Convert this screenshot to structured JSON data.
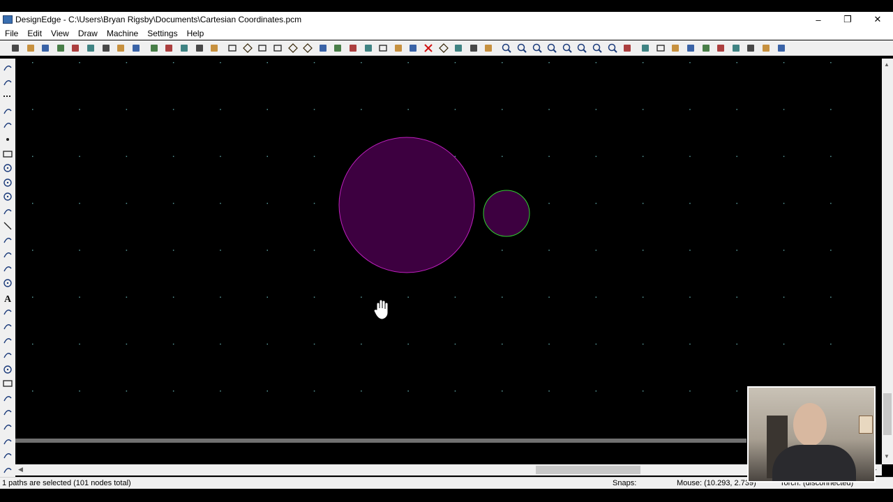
{
  "window": {
    "title": "DesignEdge - C:\\Users\\Bryan Rigsby\\Documents\\Cartesian Coordinates.pcm",
    "minimize_glyph": "–",
    "restore_glyph": "❐",
    "close_glyph": "✕"
  },
  "menu": [
    "File",
    "Edit",
    "View",
    "Draw",
    "Machine",
    "Settings",
    "Help"
  ],
  "toolbar_icons": [
    "new-file",
    "open-folder",
    "save",
    "save-all",
    "import",
    "export",
    "print",
    "print-preview",
    "properties",
    "undo",
    "redo",
    "copy",
    "paste",
    "duplicate",
    "rectangle-select",
    "parallelogram",
    "square-small",
    "rectangle",
    "diamond",
    "parallelogram-2",
    "path-arrow",
    "path-curve",
    "scissors",
    "cut-line",
    "frame",
    "explode",
    "pointer-edit",
    "delete-red",
    "rhombus",
    "loop",
    "hook",
    "cut-pattern",
    "zoom-in",
    "zoom-out",
    "zoom-window",
    "zoom-pan",
    "zoom-extents",
    "zoom-page",
    "zoom-select",
    "zoom-refresh",
    "ruler",
    "arrow-pointer",
    "select-box",
    "select-cross",
    "fill-gray",
    "dots",
    "arrow-dash",
    "snap",
    "pen",
    "layers",
    "settings-panel"
  ],
  "left_tool_icons": [
    "select-icon",
    "open-icon",
    "dotted-line-icon",
    "arc-icon",
    "curve-icon",
    "point-icon",
    "rectangle-icon",
    "circle-center-icon",
    "circle-icon",
    "circle-3pt-icon",
    "arc-2-icon",
    "line-icon",
    "polygon-icon",
    "spline-icon",
    "paint-icon",
    "spiral-icon",
    "text-icon",
    "eyedropper-icon",
    "zoom-icon",
    "burst-icon",
    "arrows-icon",
    "clock-icon",
    "frame-icon",
    "rotate-faded-icon",
    "rotate-icon",
    "rotate-2-icon",
    "undo-arc-icon",
    "redo-arc-icon",
    "undo-arc-2-icon"
  ],
  "drawing": {
    "shapes": [
      {
        "type": "circle",
        "name": "large-circle",
        "fill": "#3d0040",
        "stroke": "#c020c0"
      },
      {
        "type": "circle",
        "name": "small-circle",
        "fill": "#3d0040",
        "stroke": "#30d030"
      }
    ],
    "grid_dot_color": "#5a9a9a",
    "background": "#000000"
  },
  "status": {
    "selection": "1 paths are selected (101 nodes total)",
    "snaps_label": "Snaps:",
    "mouse": "Mouse: (10.293, 2.739)",
    "torch": "Torch: (disconnected)"
  },
  "colors": {
    "chrome": "#f0f0f0",
    "canvas": "#000000",
    "circle_fill": "#3d0040",
    "circle_stroke_magenta": "#c020c0",
    "circle_stroke_green": "#30d030"
  }
}
